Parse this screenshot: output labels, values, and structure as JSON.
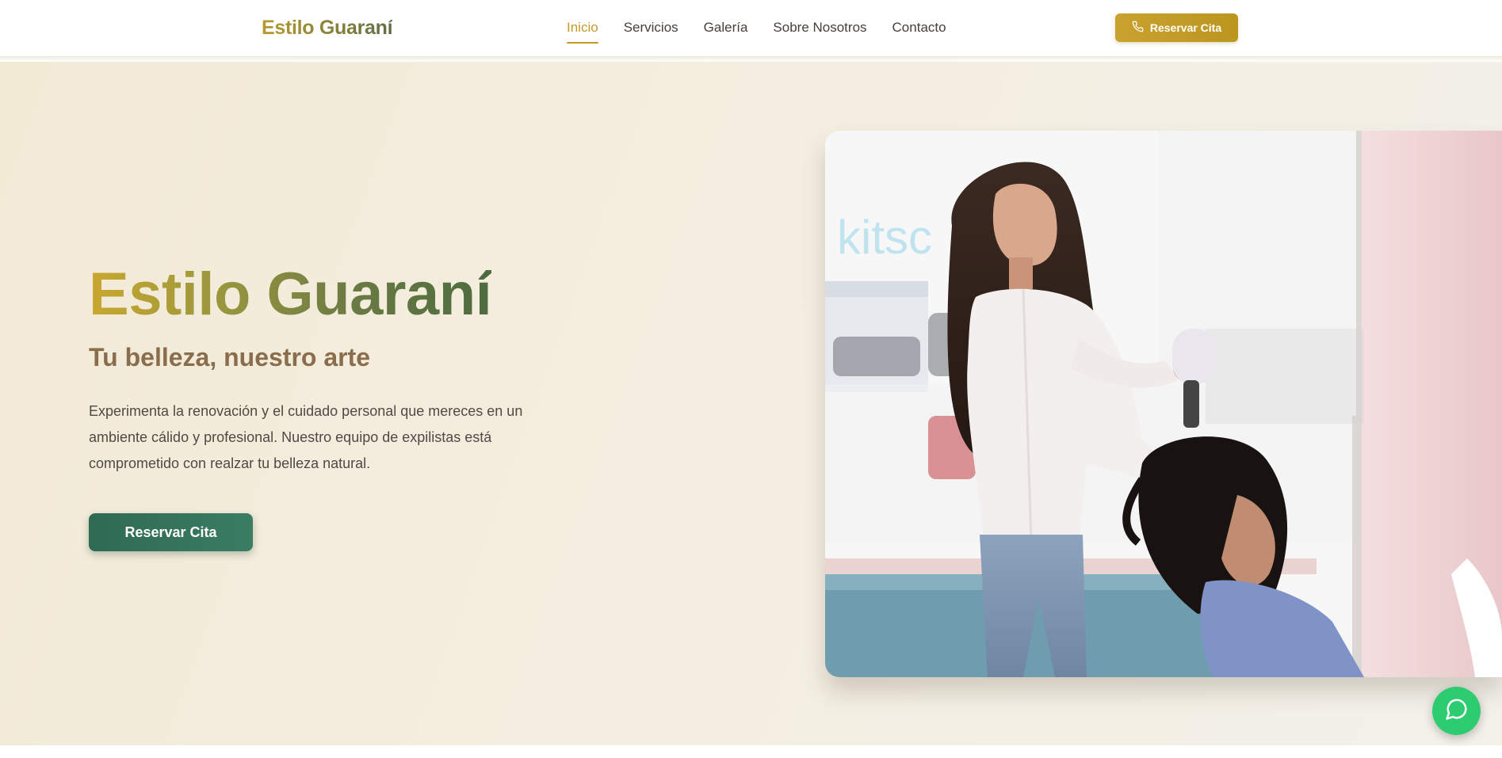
{
  "header": {
    "brand": "Estilo Guaraní",
    "nav": [
      {
        "label": "Inicio",
        "active": true
      },
      {
        "label": "Servicios",
        "active": false
      },
      {
        "label": "Galería",
        "active": false
      },
      {
        "label": "Sobre Nosotros",
        "active": false
      },
      {
        "label": "Contacto",
        "active": false
      }
    ],
    "cta_label": "Reservar Cita",
    "cta_icon": "phone-icon"
  },
  "hero": {
    "title": "Estilo Guaraní",
    "subtitle": "Tu belleza, nuestro arte",
    "body": "Experimenta la renovación y el cuidado personal que mereces en un ambiente cálido y profesional. Nuestro equipo de expilistas está comprometido con realzar tu belleza natural.",
    "cta_label": "Reservar Cita",
    "image_sign_text": "kitsc"
  },
  "chat": {
    "icon": "chat-bubble-icon"
  },
  "colors": {
    "gold": "#c49a27",
    "green": "#2f6a52",
    "chat_green": "#2ecc71",
    "cream": "#f3ead6"
  }
}
